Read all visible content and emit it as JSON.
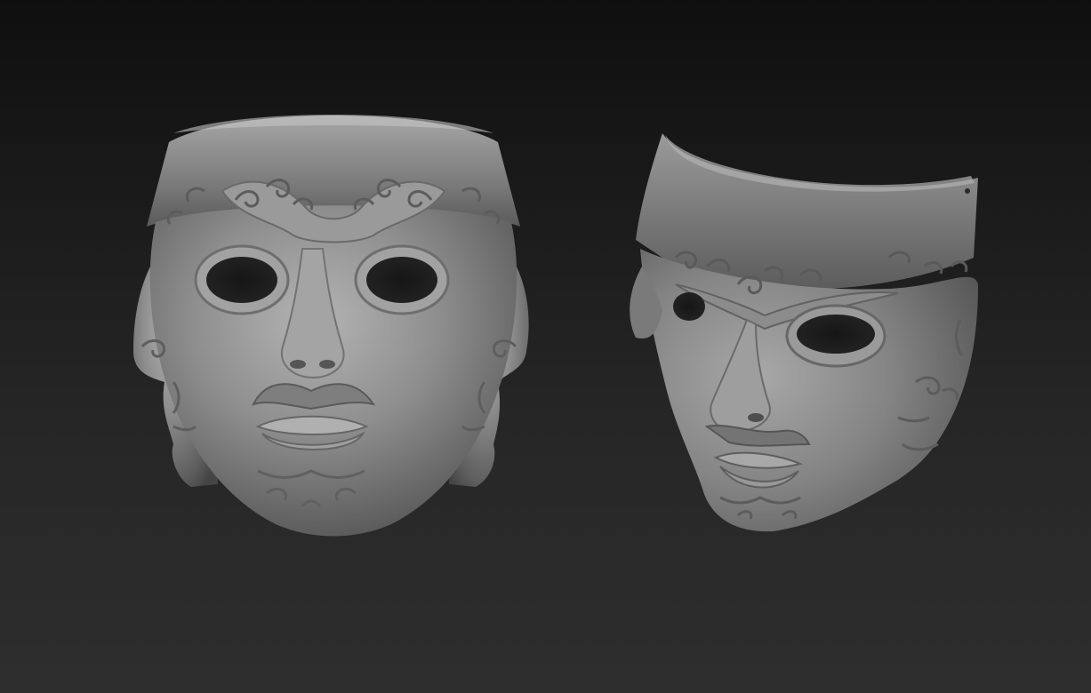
{
  "scene": {
    "background_color_top": "#0f0f0f",
    "background_color_bottom": "#2e2e2e",
    "material_color": "#8a8a8a",
    "objects": [
      {
        "name": "mask-front-view",
        "view": "front"
      },
      {
        "name": "mask-three-quarter-view",
        "view": "three-quarter"
      }
    ]
  }
}
